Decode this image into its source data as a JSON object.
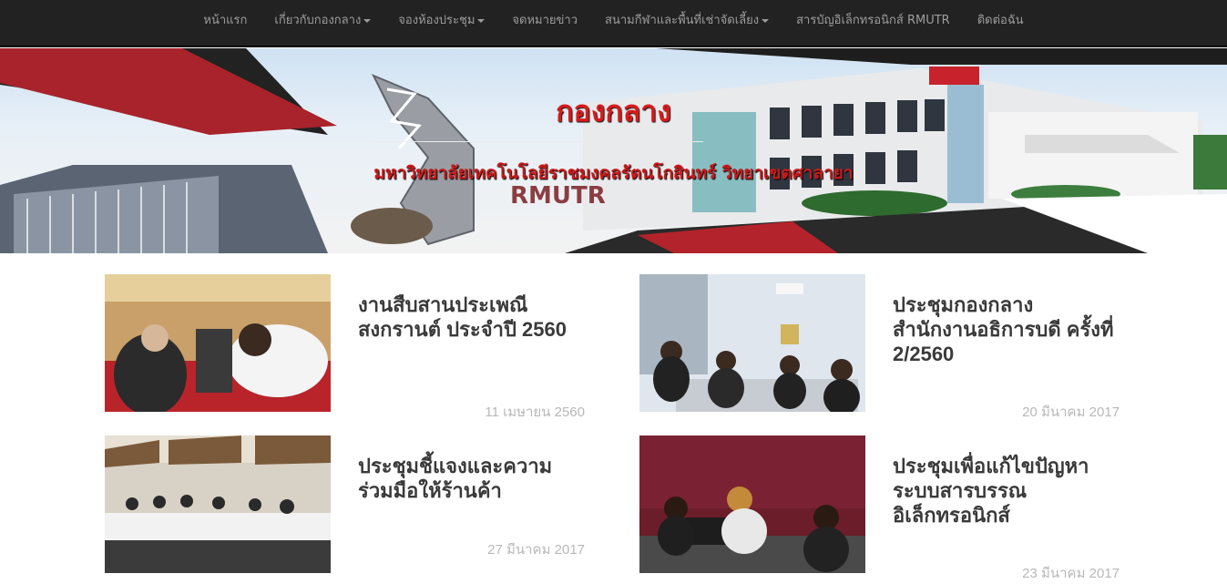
{
  "nav": {
    "items": [
      {
        "label": "หน้าแรก",
        "dropdown": false
      },
      {
        "label": "เกี่ยวกับกองกลาง",
        "dropdown": true
      },
      {
        "label": "จองห้องประชุม",
        "dropdown": true
      },
      {
        "label": "จดหมายข่าว",
        "dropdown": false
      },
      {
        "label": "สนามกีฬาและพื้นที่เช่าจัดเลี้ยง",
        "dropdown": true
      },
      {
        "label": "สารบัญอิเล็กทรอนิกส์ RMUTR",
        "dropdown": false
      },
      {
        "label": "ติดต่อฉัน",
        "dropdown": false
      }
    ]
  },
  "banner": {
    "title": "กองกลาง",
    "subtitle": "มหาวิทยาลัยเทคโนโลยีราชมงคลรัตนโกสินทร์ วิทยาเขตศาลายา",
    "logo_text": "RMUTR"
  },
  "news": [
    {
      "title": "งานสืบสานประเพณีสงกรานต์ ประจำปี 2560",
      "date": "11 เมษายน 2560"
    },
    {
      "title": "ประชุมกองกลาง สำนักงานอธิการบดี ครั้งที่ 2/2560",
      "date": "20 มีนาคม 2017"
    },
    {
      "title": "ประชุมชี้แจงและความร่วมมือให้ร้านค้า",
      "date": "27 มีนาคม 2017"
    },
    {
      "title": "ประชุมเพื่อแก้ไขปัญหาระบบสารบรรณอิเล็กทรอนิกส์",
      "date": "23 มีนาคม 2017"
    }
  ],
  "colors": {
    "navbar": "#222222",
    "nav_text": "#9d9d9d",
    "banner_red": "#d91a1a",
    "date_text": "#b8b8b8"
  }
}
